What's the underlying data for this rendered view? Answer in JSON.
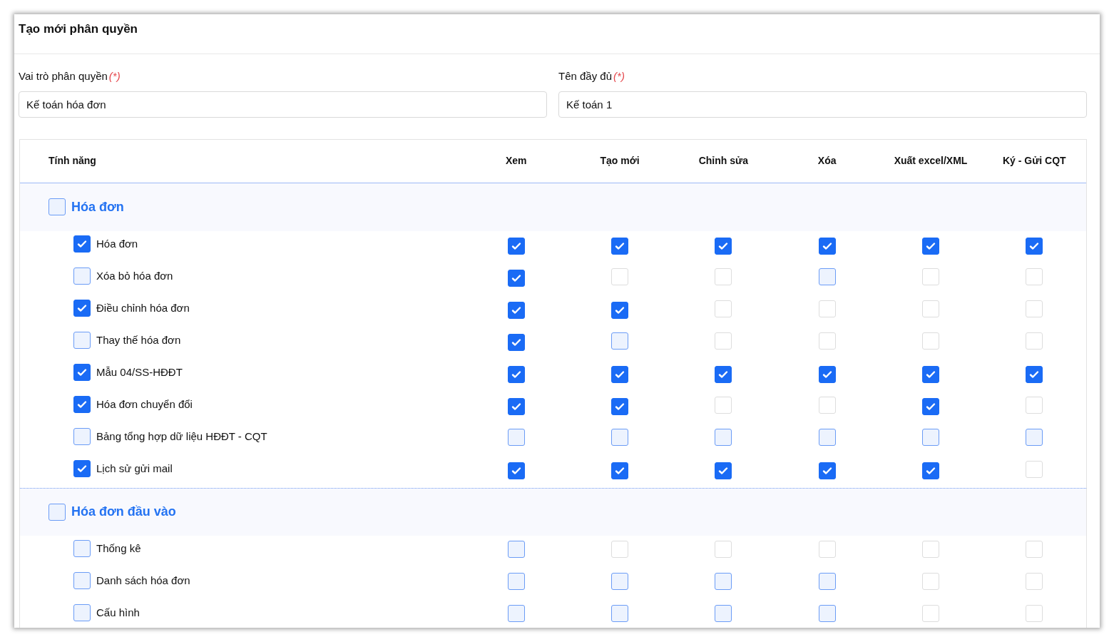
{
  "title": "Tạo mới phân quyền",
  "fields": [
    {
      "label": "Vai trò phân quyền",
      "required_mark": "(*)",
      "value": "Kế toán hóa đơn"
    },
    {
      "label": "Tên đầy đủ",
      "required_mark": "(*)",
      "value": "Kế toán 1"
    }
  ],
  "table": {
    "columns": [
      "Tính năng",
      "Xem",
      "Tạo mới",
      "Chỉnh sửa",
      "Xóa",
      "Xuất excel/XML",
      "Ký - Gửi CQT"
    ],
    "groups": [
      {
        "name": "Hóa đơn",
        "checked": false,
        "rows": [
          {
            "name": "Hóa đơn",
            "checked": true,
            "permissions": [
              {
                "checked": true,
                "disabled": false
              },
              {
                "checked": true,
                "disabled": false
              },
              {
                "checked": true,
                "disabled": false
              },
              {
                "checked": true,
                "disabled": false
              },
              {
                "checked": true,
                "disabled": false
              },
              {
                "checked": true,
                "disabled": false
              }
            ]
          },
          {
            "name": "Xóa bỏ hóa đơn",
            "checked": false,
            "permissions": [
              {
                "checked": true,
                "disabled": false
              },
              {
                "checked": false,
                "disabled": true
              },
              {
                "checked": false,
                "disabled": true
              },
              {
                "checked": false,
                "disabled": false
              },
              {
                "checked": false,
                "disabled": true
              },
              {
                "checked": false,
                "disabled": true
              }
            ]
          },
          {
            "name": "Điều chỉnh hóa đơn",
            "checked": true,
            "permissions": [
              {
                "checked": true,
                "disabled": false
              },
              {
                "checked": true,
                "disabled": false
              },
              {
                "checked": false,
                "disabled": true
              },
              {
                "checked": false,
                "disabled": true
              },
              {
                "checked": false,
                "disabled": true
              },
              {
                "checked": false,
                "disabled": true
              }
            ]
          },
          {
            "name": "Thay thế hóa đơn",
            "checked": false,
            "permissions": [
              {
                "checked": true,
                "disabled": false
              },
              {
                "checked": false,
                "disabled": false
              },
              {
                "checked": false,
                "disabled": true
              },
              {
                "checked": false,
                "disabled": true
              },
              {
                "checked": false,
                "disabled": true
              },
              {
                "checked": false,
                "disabled": true
              }
            ]
          },
          {
            "name": "Mẫu 04/SS-HĐĐT",
            "checked": true,
            "permissions": [
              {
                "checked": true,
                "disabled": false
              },
              {
                "checked": true,
                "disabled": false
              },
              {
                "checked": true,
                "disabled": false
              },
              {
                "checked": true,
                "disabled": false
              },
              {
                "checked": true,
                "disabled": false
              },
              {
                "checked": true,
                "disabled": false
              }
            ]
          },
          {
            "name": "Hóa đơn chuyển đổi",
            "checked": true,
            "permissions": [
              {
                "checked": true,
                "disabled": false
              },
              {
                "checked": true,
                "disabled": false
              },
              {
                "checked": false,
                "disabled": true
              },
              {
                "checked": false,
                "disabled": true
              },
              {
                "checked": true,
                "disabled": false
              },
              {
                "checked": false,
                "disabled": true
              }
            ]
          },
          {
            "name": "Bảng tổng hợp dữ liệu HĐĐT - CQT",
            "checked": false,
            "permissions": [
              {
                "checked": false,
                "disabled": false
              },
              {
                "checked": false,
                "disabled": false
              },
              {
                "checked": false,
                "disabled": false
              },
              {
                "checked": false,
                "disabled": false
              },
              {
                "checked": false,
                "disabled": false
              },
              {
                "checked": false,
                "disabled": false
              }
            ]
          },
          {
            "name": "Lịch sử gửi mail",
            "checked": true,
            "permissions": [
              {
                "checked": true,
                "disabled": false
              },
              {
                "checked": true,
                "disabled": false
              },
              {
                "checked": true,
                "disabled": false
              },
              {
                "checked": true,
                "disabled": false
              },
              {
                "checked": true,
                "disabled": false
              },
              {
                "checked": false,
                "disabled": true
              }
            ]
          }
        ]
      },
      {
        "name": "Hóa đơn đầu vào",
        "checked": false,
        "rows": [
          {
            "name": "Thống kê",
            "checked": false,
            "permissions": [
              {
                "checked": false,
                "disabled": false
              },
              {
                "checked": false,
                "disabled": true
              },
              {
                "checked": false,
                "disabled": true
              },
              {
                "checked": false,
                "disabled": true
              },
              {
                "checked": false,
                "disabled": true
              },
              {
                "checked": false,
                "disabled": true
              }
            ]
          },
          {
            "name": "Danh sách hóa đơn",
            "checked": false,
            "permissions": [
              {
                "checked": false,
                "disabled": false
              },
              {
                "checked": false,
                "disabled": false
              },
              {
                "checked": false,
                "disabled": false
              },
              {
                "checked": false,
                "disabled": false
              },
              {
                "checked": false,
                "disabled": true
              },
              {
                "checked": false,
                "disabled": true
              }
            ]
          },
          {
            "name": "Cấu hình",
            "checked": false,
            "permissions": [
              {
                "checked": false,
                "disabled": false
              },
              {
                "checked": false,
                "disabled": false
              },
              {
                "checked": false,
                "disabled": false
              },
              {
                "checked": false,
                "disabled": false
              },
              {
                "checked": false,
                "disabled": true
              },
              {
                "checked": false,
                "disabled": true
              }
            ]
          }
        ]
      }
    ]
  }
}
